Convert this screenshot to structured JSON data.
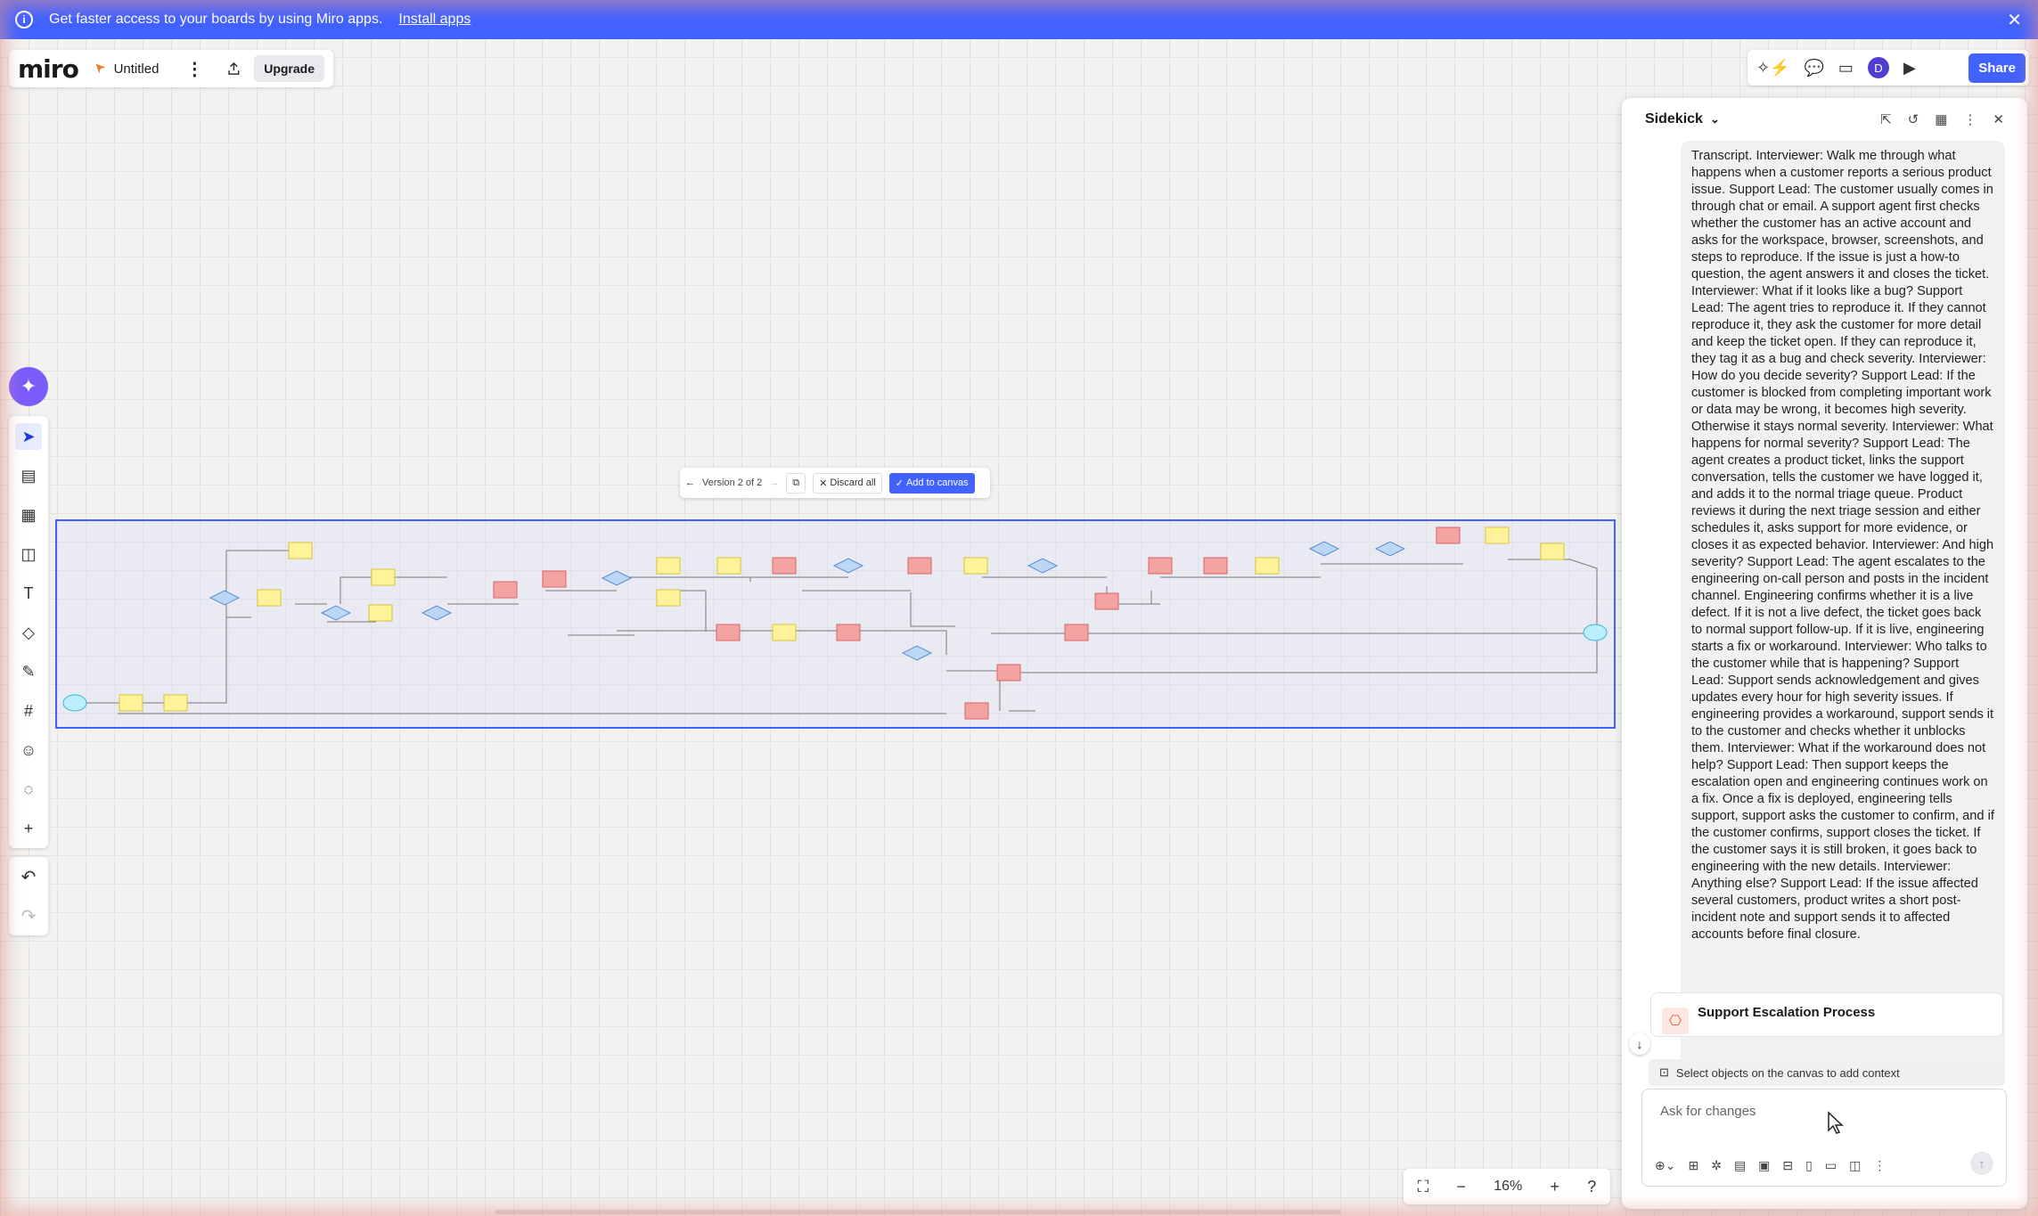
{
  "banner": {
    "message": "Get faster access to your boards by using Miro apps.",
    "link": "Install apps",
    "close": "✕"
  },
  "topbar": {
    "logo": "miro",
    "board_title": "Untitled",
    "kebab": "⋮",
    "upgrade": "Upgrade"
  },
  "topright": {
    "avatar_initial": "D",
    "share": "Share"
  },
  "version_bar": {
    "label": "Version 2 of 2",
    "discard": "Discard all",
    "add": "Add to canvas"
  },
  "zoom": {
    "level": "16%"
  },
  "sidekick": {
    "title": "Sidekick",
    "transcript": "Transcript. Interviewer: Walk me through what happens when a customer reports a serious product issue. Support Lead: The customer usually comes in through chat or email. A support agent first checks whether the customer has an active account and asks for the workspace, browser, screenshots, and steps to reproduce. If the issue is just a how-to question, the agent answers it and closes the ticket. Interviewer: What if it looks like a bug? Support Lead: The agent tries to reproduce it. If they cannot reproduce it, they ask the customer for more detail and keep the ticket open. If they can reproduce it, they tag it as a bug and check severity. Interviewer: How do you decide severity? Support Lead: If the customer is blocked from completing important work or data may be wrong, it becomes high severity. Otherwise it stays normal severity. Interviewer: What happens for normal severity? Support Lead: The agent creates a product ticket, links the support conversation, tells the customer we have logged it, and adds it to the normal triage queue. Product reviews it during the next triage session and either schedules it, asks support for more evidence, or closes it as expected behavior. Interviewer: And high severity? Support Lead: The agent escalates to the engineering on-call person and posts in the incident channel. Engineering confirms whether it is a live defect. If it is not a live defect, the ticket goes back to normal support follow-up. If it is live, engineering starts a fix or workaround. Interviewer: Who talks to the customer while that is happening? Support Lead: Support sends acknowledgement and gives updates every hour for high severity issues. If engineering provides a workaround, support sends it to the customer and checks whether it unblocks them. Interviewer: What if the workaround does not help? Support Lead: Then support keeps the escalation open and engineering continues work on a fix. Once a fix is deployed, engineering tells support, support asks the customer to confirm, and if the customer confirms, support closes the ticket. If the customer says it is still broken, it goes back to engineering with the new details. Interviewer: Anything else? Support Lead: If the issue affected several customers, product writes a short post-incident note and support sends it to affected accounts before final closure.",
    "card_title": "Support Escalation Process",
    "context_hint": "Select objects on the canvas to add context",
    "input_placeholder": "Ask for changes"
  },
  "colors": {
    "brand_blue": "#4262ff",
    "sticky_yellow": "#fff39a",
    "sticky_red": "#f4a3a3",
    "decision_blue": "#bcd6f6",
    "start_cyan": "#bdeefb"
  }
}
